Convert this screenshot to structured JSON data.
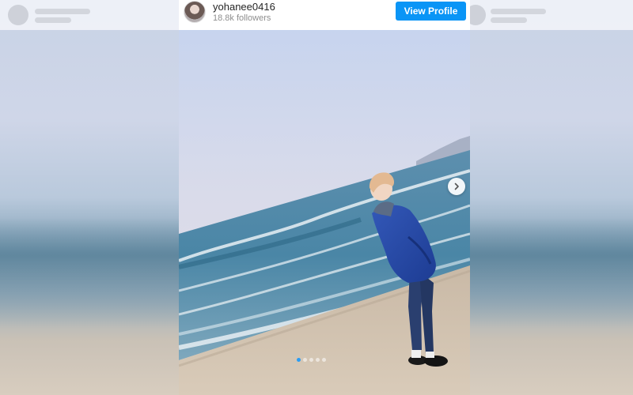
{
  "post": {
    "username": "yohanee0416",
    "followers": "18.8k followers",
    "view_profile_label": "View Profile"
  },
  "carousel": {
    "slide_count": 5,
    "active_index": 0
  },
  "colors": {
    "button_blue": "#0a95f6",
    "active_dot": "#2a9df4"
  },
  "icons": {
    "next": "chevron-right-icon",
    "avatar": "profile-avatar"
  }
}
